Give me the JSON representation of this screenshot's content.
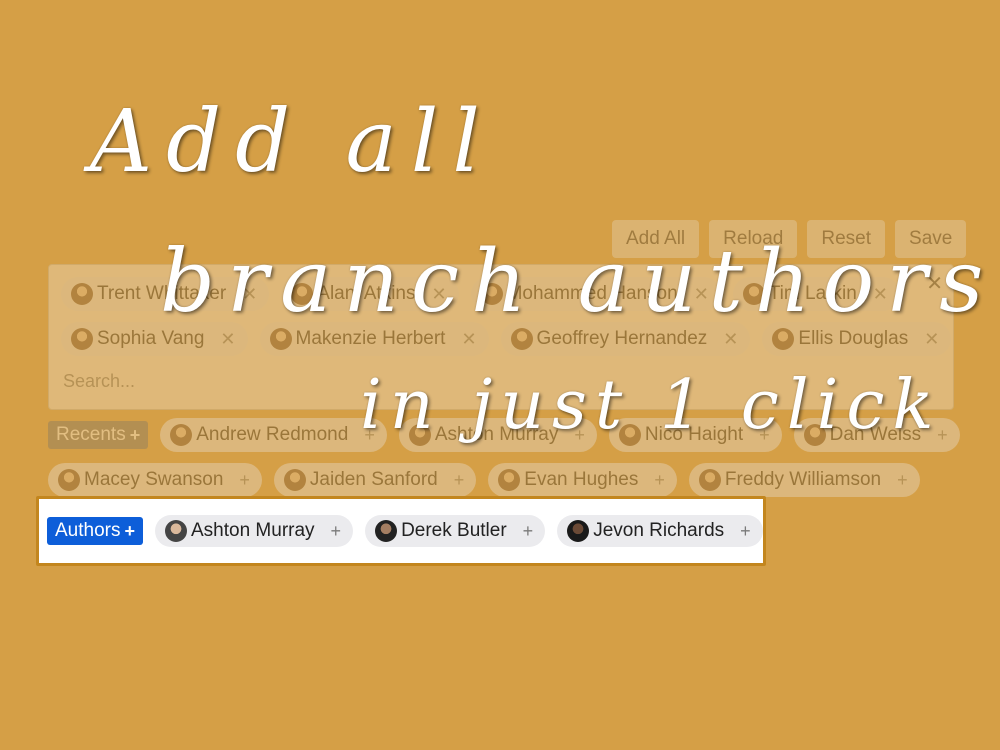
{
  "toolbar": {
    "add_all": "Add All",
    "reload": "Reload",
    "reset": "Reset",
    "save": "Save"
  },
  "selected": {
    "items": [
      {
        "name": "Trent Whittaker",
        "remove": "✕"
      },
      {
        "name": "Alani Atkins",
        "remove": "✕"
      },
      {
        "name": "Mohammed Hanson",
        "remove": "✕"
      },
      {
        "name": "Tim Larkin",
        "remove": "✕"
      },
      {
        "name": "Sophia Vang",
        "remove": "✕"
      },
      {
        "name": "Makenzie Herbert",
        "remove": "✕"
      },
      {
        "name": "Geoffrey Hernandez",
        "remove": "✕"
      },
      {
        "name": "Ellis Douglas",
        "remove": "✕"
      }
    ],
    "clear_all": "✕"
  },
  "search": {
    "placeholder": "Search..."
  },
  "recents": {
    "label": "Recents",
    "add_symbol": "+",
    "items": [
      {
        "name": "Andrew Redmond",
        "add": "+"
      },
      {
        "name": "Ashton Murray",
        "add": "+"
      },
      {
        "name": "Nico Haight",
        "add": "+"
      },
      {
        "name": "Dan Weiss",
        "add": "+"
      },
      {
        "name": "Macey Swanson",
        "add": "+"
      },
      {
        "name": "Jaiden Sanford",
        "add": "+"
      },
      {
        "name": "Evan Hughes",
        "add": "+"
      },
      {
        "name": "Freddy Williamson",
        "add": "+"
      }
    ]
  },
  "authors": {
    "label": "Authors",
    "add_symbol": "+",
    "items": [
      {
        "name": "Ashton Murray",
        "add": "+"
      },
      {
        "name": "Derek Butler",
        "add": "+"
      },
      {
        "name": "Jevon Richards",
        "add": "+"
      }
    ]
  },
  "headline": {
    "line1": "Add all",
    "line2": "branch authors",
    "line3": "in just 1 click"
  },
  "colors": {
    "background": "#d59f46",
    "authors_button": "#0d5ed9",
    "highlight_border": "#c3861e"
  }
}
